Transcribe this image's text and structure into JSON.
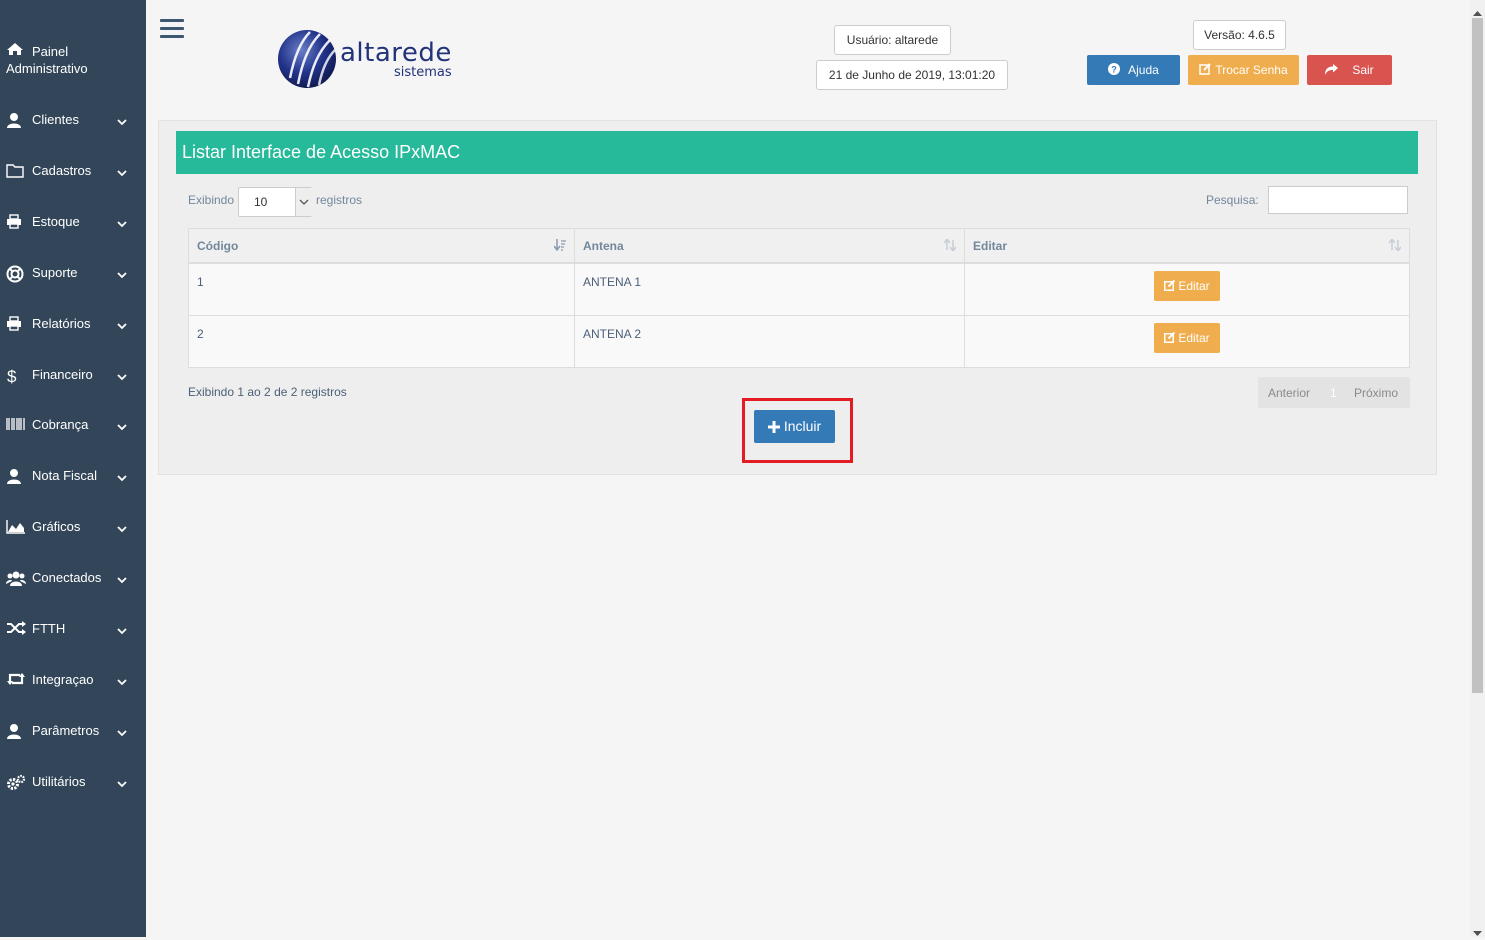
{
  "sidebar": {
    "home": {
      "line1": "Painel",
      "line2": "Administrativo",
      "icon": "home-icon"
    },
    "items": [
      {
        "label": "Clientes",
        "icon": "user-icon"
      },
      {
        "label": "Cadastros",
        "icon": "folder-icon"
      },
      {
        "label": "Estoque",
        "icon": "printer-icon"
      },
      {
        "label": "Suporte",
        "icon": "lifebuoy-icon"
      },
      {
        "label": "Relatórios",
        "icon": "printer-icon"
      },
      {
        "label": "Financeiro",
        "icon": "dollar-icon"
      },
      {
        "label": "Cobrança",
        "icon": "barcode-icon"
      },
      {
        "label": "Nota Fiscal",
        "icon": "user-icon"
      },
      {
        "label": "Gráficos",
        "icon": "area-chart-icon"
      },
      {
        "label": "Conectados",
        "icon": "users-icon"
      },
      {
        "label": "FTTH",
        "icon": "random-icon"
      },
      {
        "label": "Integraçao",
        "icon": "retweet-icon"
      },
      {
        "label": "Parâmetros",
        "icon": "user-icon"
      },
      {
        "label": "Utilitários",
        "icon": "cogs-icon"
      }
    ]
  },
  "header": {
    "logo_text": "altarede",
    "logo_sub": "sistemas",
    "user": "Usuário: altarede",
    "datetime": "21 de Junho de 2019, 13:01:20",
    "version": "Versão: 4.6.5",
    "help_label": "Ajuda",
    "change_password_label": "Trocar Senha",
    "exit_label": "Sair"
  },
  "panel": {
    "title": "Listar Interface de Acesso IPxMAC",
    "length_prefix": "Exibindo",
    "length_value": "10",
    "length_suffix": "registros",
    "search_label": "Pesquisa:",
    "search_value": "",
    "columns": [
      "Código",
      "Antena",
      "Editar"
    ],
    "rows": [
      {
        "codigo": "1",
        "antena": "ANTENA 1",
        "action": "Editar"
      },
      {
        "codigo": "2",
        "antena": "ANTENA 2",
        "action": "Editar"
      }
    ],
    "info": "Exibindo 1 ao 2 de 2 registros",
    "pager": {
      "prev": "Anterior",
      "page": "1",
      "next": "Próximo"
    },
    "include_label": "Incluir"
  },
  "colors": {
    "sidebar_bg": "#334659",
    "panel_title_bg": "#26b99a",
    "primary": "#337ab7",
    "warning": "#f0ad4e",
    "danger": "#d9534f",
    "highlight_frame": "#e41b23"
  }
}
